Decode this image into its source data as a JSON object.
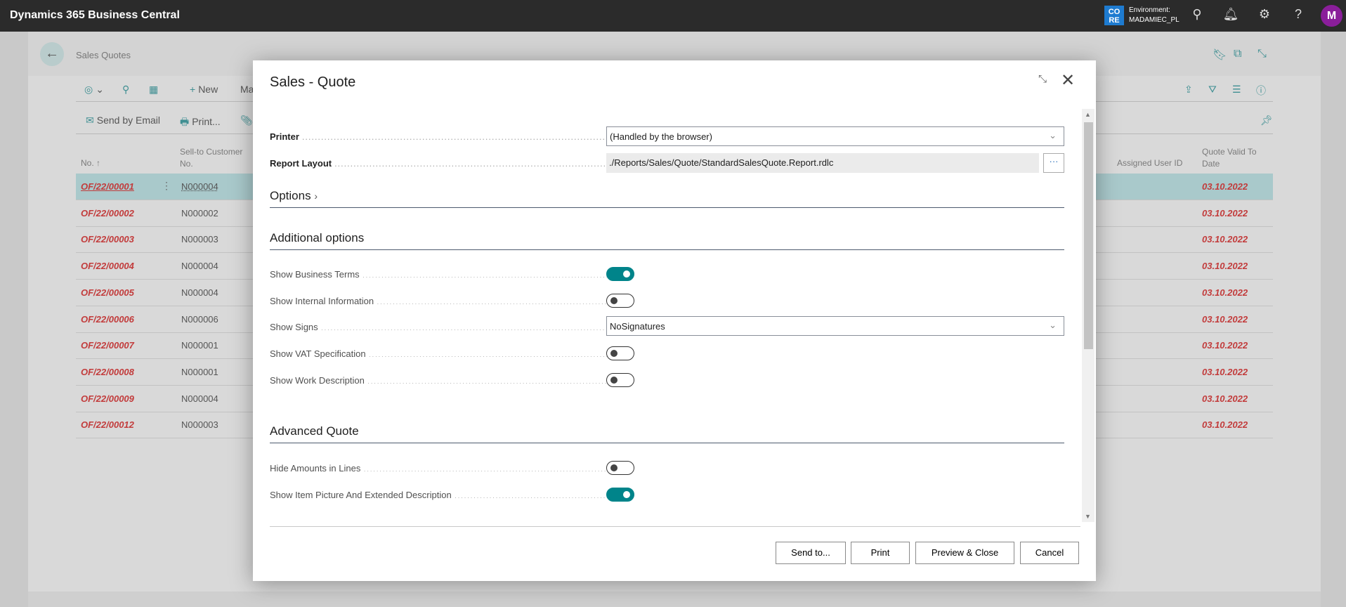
{
  "topbar": {
    "title": "Dynamics 365 Business Central",
    "env_badge": "CO RE",
    "env_label": "Environment:",
    "env_name": "MADAMIEC_PL",
    "avatar": "M"
  },
  "page": {
    "breadcrumb": "Sales Quotes",
    "toolbar": {
      "new": "New",
      "manage": "Ma"
    },
    "actions": {
      "send_email": "Send by Email",
      "print": "Print..."
    },
    "columns": {
      "no": "No. ↑",
      "customer": "Sell-to Customer No.",
      "assigned": "Assigned User ID",
      "valid_to": "Quote Valid To Date"
    },
    "rows": [
      {
        "no": "OF/22/00001",
        "customer": "N000004",
        "date": "03.10.2022"
      },
      {
        "no": "OF/22/00002",
        "customer": "N000002",
        "date": "03.10.2022"
      },
      {
        "no": "OF/22/00003",
        "customer": "N000003",
        "date": "03.10.2022"
      },
      {
        "no": "OF/22/00004",
        "customer": "N000004",
        "date": "03.10.2022"
      },
      {
        "no": "OF/22/00005",
        "customer": "N000004",
        "date": "03.10.2022"
      },
      {
        "no": "OF/22/00006",
        "customer": "N000006",
        "date": "03.10.2022"
      },
      {
        "no": "OF/22/00007",
        "customer": "N000001",
        "date": "03.10.2022"
      },
      {
        "no": "OF/22/00008",
        "customer": "N000001",
        "date": "03.10.2022"
      },
      {
        "no": "OF/22/00009",
        "customer": "N000004",
        "date": "03.10.2022"
      },
      {
        "no": "OF/22/00012",
        "customer": "N000003",
        "date": "03.10.2022"
      }
    ]
  },
  "dialog": {
    "title": "Sales - Quote",
    "printer_label": "Printer",
    "printer_value": "(Handled by the browser)",
    "layout_label": "Report Layout",
    "layout_value": "./Reports/Sales/Quote/StandardSalesQuote.Report.rdlc",
    "ellipsis": "···",
    "options": "Options",
    "additional": "Additional options",
    "fields": [
      {
        "label": "Show Business Terms",
        "on": true
      },
      {
        "label": "Show Internal Information",
        "on": false
      },
      {
        "label": "Show Signs",
        "value": "NoSignatures"
      },
      {
        "label": "Show VAT Specification",
        "on": false
      },
      {
        "label": "Show Work Description",
        "on": false
      }
    ],
    "advanced": "Advanced Quote",
    "advanced_fields": [
      {
        "label": "Hide Amounts in Lines",
        "on": false
      },
      {
        "label": "Show Item Picture And Extended Description",
        "on": true
      }
    ],
    "buttons": {
      "send_to": "Send to...",
      "print": "Print",
      "preview_close": "Preview & Close",
      "cancel": "Cancel"
    }
  },
  "colors": {
    "accent": "#00848a",
    "link_red": "#c23b3b",
    "selected_row": "#a9c9cb",
    "topbar": "#2b2b2b"
  }
}
